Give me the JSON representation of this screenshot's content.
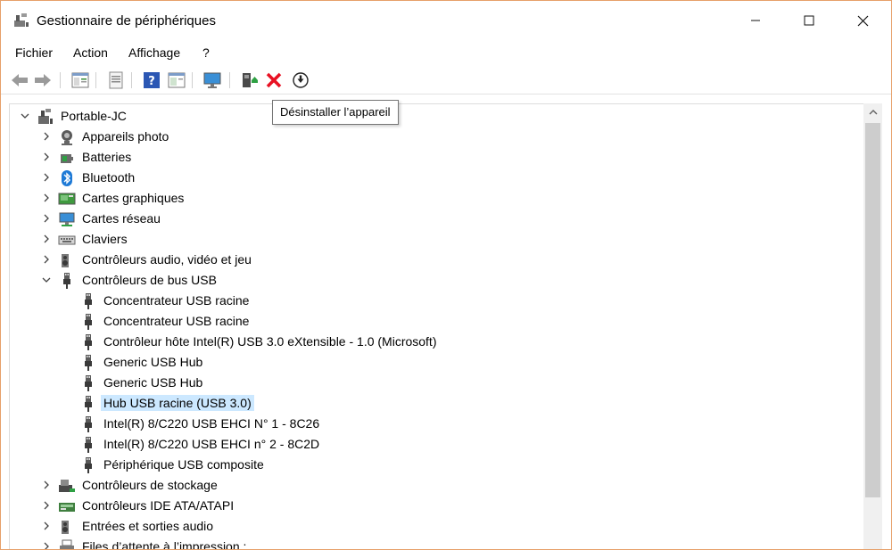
{
  "window": {
    "title": "Gestionnaire de périphériques",
    "minimize_icon": "minimize-icon",
    "maximize_icon": "maximize-icon",
    "close_icon": "close-icon"
  },
  "menu": {
    "items": [
      "Fichier",
      "Action",
      "Affichage",
      "?"
    ]
  },
  "toolbar": {
    "buttons": [
      "back-arrow-icon",
      "forward-arrow-icon",
      "properties-panel-icon",
      "document-icon",
      "help-icon",
      "panel-icon",
      "monitor-icon",
      "update-driver-icon",
      "uninstall-x-icon",
      "download-icon"
    ],
    "tooltip": "Désinstaller l’appareil"
  },
  "tree": {
    "root": "Portable-JC",
    "items": [
      {
        "label": "Appareils photo",
        "icon": "camera-icon",
        "expander": "collapsed"
      },
      {
        "label": "Batteries",
        "icon": "battery-icon",
        "expander": "collapsed"
      },
      {
        "label": "Bluetooth",
        "icon": "bluetooth-icon",
        "expander": "collapsed"
      },
      {
        "label": "Cartes graphiques",
        "icon": "display-adapter-icon",
        "expander": "collapsed"
      },
      {
        "label": "Cartes réseau",
        "icon": "network-adapter-icon",
        "expander": "collapsed"
      },
      {
        "label": "Claviers",
        "icon": "keyboard-icon",
        "expander": "collapsed"
      },
      {
        "label": "Contrôleurs audio, vidéo et jeu",
        "icon": "speaker-icon",
        "expander": "collapsed"
      },
      {
        "label": "Contrôleurs de bus USB",
        "icon": "usb-icon",
        "expander": "expanded"
      },
      {
        "label": "Concentrateur USB racine",
        "icon": "usb-icon",
        "expander": "none",
        "child": true
      },
      {
        "label": "Concentrateur USB racine",
        "icon": "usb-icon",
        "expander": "none",
        "child": true
      },
      {
        "label": "Contrôleur hôte Intel(R) USB 3.0 eXtensible - 1.0 (Microsoft)",
        "icon": "usb-icon",
        "expander": "none",
        "child": true
      },
      {
        "label": "Generic USB Hub",
        "icon": "usb-icon",
        "expander": "none",
        "child": true
      },
      {
        "label": "Generic USB Hub",
        "icon": "usb-icon",
        "expander": "none",
        "child": true
      },
      {
        "label": "Hub USB racine (USB 3.0)",
        "icon": "usb-icon",
        "expander": "none",
        "child": true,
        "selected": true
      },
      {
        "label": "Intel(R) 8/C220 USB EHCI N° 1 - 8C26",
        "icon": "usb-icon",
        "expander": "none",
        "child": true
      },
      {
        "label": "Intel(R) 8/C220 USB EHCI n° 2 - 8C2D",
        "icon": "usb-icon",
        "expander": "none",
        "child": true
      },
      {
        "label": "Périphérique USB composite",
        "icon": "usb-icon",
        "expander": "none",
        "child": true
      },
      {
        "label": "Contrôleurs de stockage",
        "icon": "storage-controller-icon",
        "expander": "collapsed"
      },
      {
        "label": "Contrôleurs IDE ATA/ATAPI",
        "icon": "ide-controller-icon",
        "expander": "collapsed"
      },
      {
        "label": "Entrées et sorties audio",
        "icon": "speaker-icon",
        "expander": "collapsed"
      },
      {
        "label": "Files d’attente à l’impression :",
        "icon": "printer-icon",
        "expander": "collapsed"
      }
    ]
  },
  "colors": {
    "window_border": "#e6a06a",
    "selection": "#cce8ff",
    "uninstall_red": "#e81123"
  }
}
